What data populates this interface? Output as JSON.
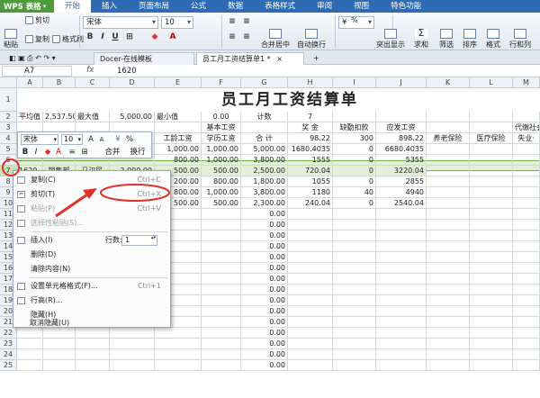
{
  "menubar": {
    "app_label": "WPS 表格",
    "items": [
      "开始",
      "插入",
      "页面布局",
      "公式",
      "数据",
      "表格样式",
      "审阅",
      "视图",
      "特色功能"
    ],
    "active_index": 0
  },
  "ribbon": {
    "cut": "剪切",
    "paste": "粘贴",
    "copy": "复制",
    "format_painter": "格式刷",
    "font_name": "宋体",
    "font_size": "10",
    "bold": "B",
    "italic": "I",
    "underline": "U",
    "merge_center": "合并居中",
    "wrap_text": "自动换行",
    "percent": "%",
    "highlight_dup": "突出显示",
    "sum": "求和",
    "filter": "筛选",
    "sort": "排序",
    "format": "格式",
    "row_col": "行和列"
  },
  "doc_tabs": {
    "tab1": "Docer-在线模板",
    "tab2": "员工月工资结算单1 *",
    "add": "+"
  },
  "formula_bar": {
    "cell_ref": "A7",
    "fx": "fx",
    "value": "1620"
  },
  "columns": [
    "A",
    "B",
    "C",
    "D",
    "E",
    "F",
    "G",
    "H",
    "I",
    "J",
    "K",
    "L",
    "M"
  ],
  "rows": [
    "1",
    "2",
    "3",
    "4",
    "5",
    "6",
    "7",
    "8",
    "9",
    "10",
    "11",
    "12",
    "13",
    "14",
    "15",
    "16",
    "17",
    "18",
    "19",
    "20",
    "21",
    "22",
    "23",
    "24",
    "25"
  ],
  "sheet": {
    "title": "员工月工资结算单",
    "row2": {
      "a": "平均值",
      "b": "2,537.50",
      "c": "最大值",
      "d": "5,000.00",
      "e": "最小值",
      "f": "0.00",
      "g": "计数",
      "h": "7"
    },
    "row3": {
      "basic_wage": "基本工资",
      "bonus": "奖  金",
      "absence_deduction": "缺勤扣款",
      "payable": "应发工资",
      "withholding": "代缴社会"
    },
    "row4": {
      "seniority": "工龄工资",
      "education": "学历工资",
      "total": "合  计",
      "pension": "养老保险",
      "medical": "医疗保险",
      "unemployment": "失业·"
    },
    "row7": {
      "id": "1620",
      "dept": "销售部",
      "name": "马汉民",
      "base": "2,000.00"
    },
    "data": [
      {
        "e": "200.00",
        "f": "400.00",
        "g": "1,100.00",
        "h": "98.22",
        "i": "300",
        "j": "898.22"
      },
      {
        "e": "1,000.00",
        "f": "1,000.00",
        "g": "5,000.00",
        "h": "1680.4035",
        "i": "0",
        "j": "6680.4035"
      },
      {
        "e": "800.00",
        "f": "1,000.00",
        "g": "3,800.00",
        "h": "1555",
        "i": "0",
        "j": "5355"
      },
      {
        "e": "500.00",
        "f": "500.00",
        "g": "2,500.00",
        "h": "720.04",
        "i": "0",
        "j": "3220.04"
      },
      {
        "e": "200.00",
        "f": "800.00",
        "g": "1,800.00",
        "h": "1055",
        "i": "0",
        "j": "2855"
      },
      {
        "e": "800.00",
        "f": "1,000.00",
        "g": "3,800.00",
        "h": "1180",
        "i": "40",
        "j": "4940"
      },
      {
        "e": "500.00",
        "f": "500.00",
        "g": "2,300.00",
        "h": "240.04",
        "i": "0",
        "j": "2540.04"
      }
    ],
    "zero_value": "0.00"
  },
  "mini_toolbar": {
    "font": "宋体",
    "size": "10",
    "bold": "B",
    "italic": "I",
    "merge": "合并",
    "wrap": "换行"
  },
  "context_menu": {
    "copy": "复制(C)",
    "copy_sc": "Ctrl+C",
    "cut": "剪切(T)",
    "cut_sc": "Ctrl+X",
    "paste": "粘贴(P)",
    "paste_sc": "Ctrl+V",
    "paste_special": "选择性粘贴(S)...",
    "insert": "插入(I)",
    "row_count_label": "行数:",
    "row_count": "1",
    "delete": "删除(D)",
    "clear": "清除内容(N)",
    "format_cells": "设置单元格格式(F)...",
    "format_sc": "Ctrl+1",
    "row_height": "行高(R)...",
    "hide": "隐藏(H)",
    "unhide": "取消隐藏(U)"
  },
  "annotation_color": "#e0302b",
  "selection_color": "#70ad47"
}
